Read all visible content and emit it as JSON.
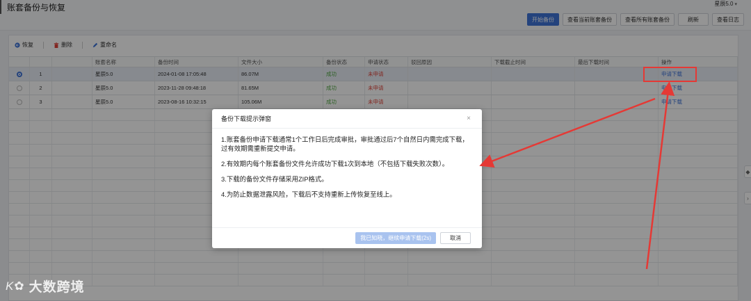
{
  "app": {
    "title": "账套备份与恢复",
    "version_select": "星辰5.0"
  },
  "toolbar": {
    "start_backup": "开始备份",
    "view_current": "查看当前账套备份",
    "view_all": "查看所有账套备份",
    "refresh": "刷新",
    "view_log": "查看日志"
  },
  "actions": {
    "restore": "恢复",
    "delete": "删除",
    "rename": "重命名"
  },
  "table": {
    "headers": [
      "",
      "",
      "账套名称",
      "备份时间",
      "文件大小",
      "备份状态",
      "申请状态",
      "驳回原因",
      "下载截止时间",
      "最后下载时间",
      "操作"
    ],
    "rows": [
      {
        "index": "1",
        "name": "星辰5.0",
        "time": "2024-01-08 17:05:48",
        "size": "86.07M",
        "backup_status": "成功",
        "apply_status": "未申请",
        "reason": "",
        "deadline": "",
        "last_download": "",
        "op": "申请下载"
      },
      {
        "index": "2",
        "name": "星辰5.0",
        "time": "2023-11-28 09:48:18",
        "size": "81.65M",
        "backup_status": "成功",
        "apply_status": "未申请",
        "reason": "",
        "deadline": "",
        "last_download": "",
        "op": "申请下载"
      },
      {
        "index": "3",
        "name": "星辰5.0",
        "time": "2023-08-16 10:32:15",
        "size": "105.06M",
        "backup_status": "成功",
        "apply_status": "未申请",
        "reason": "",
        "deadline": "",
        "last_download": "",
        "op": "申请下载"
      }
    ]
  },
  "modal": {
    "title": "备份下载提示弹窗",
    "close": "×",
    "lines": [
      "1.账套备份申请下载通常1个工作日后完成审批，审批通过后7个自然日内需完成下载，过有效期需重新提交申请。",
      "2.有效期内每个账套备份文件允许成功下载1次到本地（不包括下载失败次数）。",
      "3.下载的备份文件存储采用ZIP格式。",
      "4.为防止数据泄露风险，下载后不支持重新上传恢复至线上。"
    ],
    "confirm": "我已知晓，继续申请下载(2s)",
    "cancel": "取消"
  },
  "watermark": {
    "logo": "K✿",
    "text": "大数跨境"
  },
  "colors": {
    "primary": "#3f74d8",
    "success": "#52a843",
    "danger": "#e0433a",
    "annotation": "#e53935"
  }
}
